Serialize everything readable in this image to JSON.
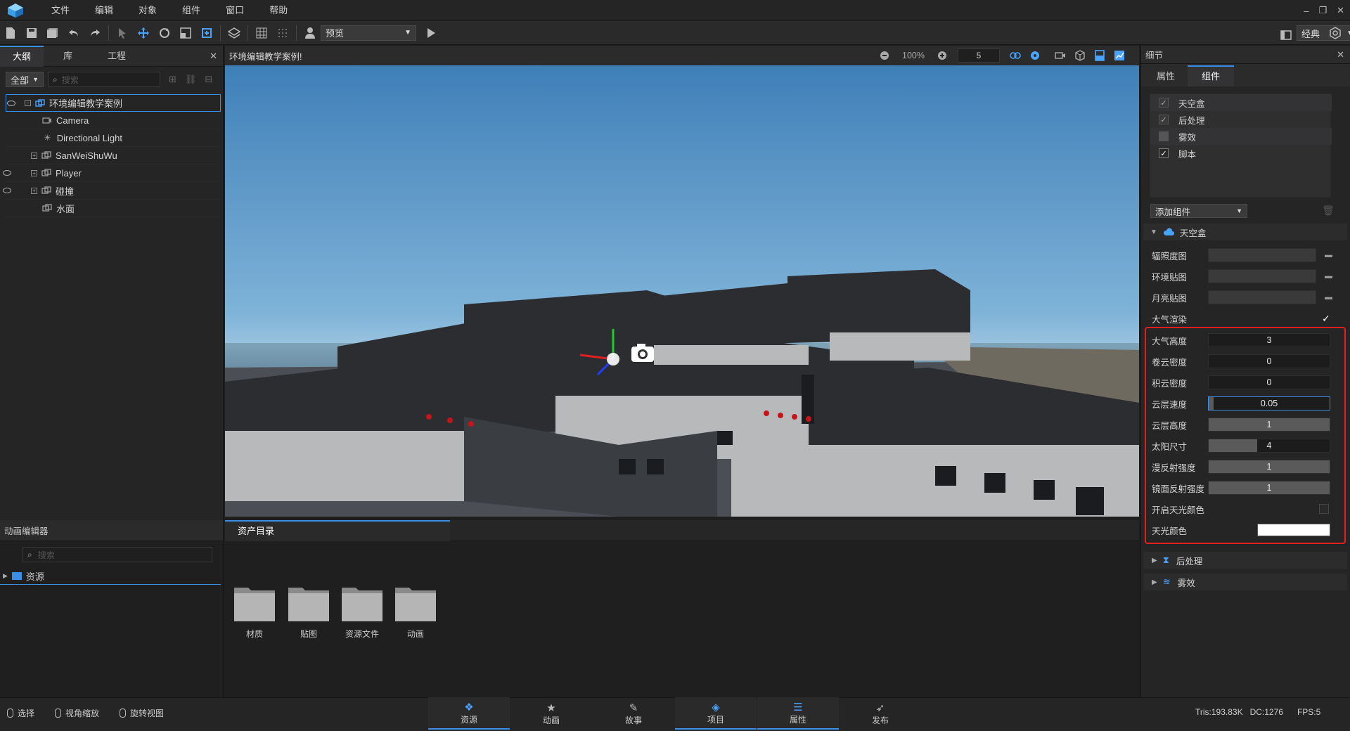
{
  "menu": {
    "items": [
      "文件",
      "编辑",
      "对象",
      "组件",
      "窗口",
      "帮助"
    ]
  },
  "window_controls": {
    "minimize": "–",
    "restore": "❐",
    "close": "✕"
  },
  "toolbar": {
    "preview_select": "预览",
    "layout_select": "经典"
  },
  "outline": {
    "tabs": [
      "大纲",
      "库",
      "工程"
    ],
    "filter": "全部",
    "search_placeholder": "搜索",
    "tree": [
      {
        "label": "环境编辑教学案例"
      },
      {
        "label": "Camera"
      },
      {
        "label": "Directional Light"
      },
      {
        "label": "SanWeiShuWu"
      },
      {
        "label": "Player"
      },
      {
        "label": "碰撞"
      },
      {
        "label": "水面"
      }
    ]
  },
  "viewport": {
    "title": "环境编辑教学案例!",
    "zoom": "100%",
    "speed": "5"
  },
  "details": {
    "title": "细节",
    "tabs": [
      "属性",
      "组件"
    ],
    "components": [
      {
        "label": "天空盒",
        "checked": true
      },
      {
        "label": "后处理",
        "checked": true
      },
      {
        "label": "雾效",
        "checked": false
      },
      {
        "label": "脚本",
        "checked": true
      }
    ],
    "add_component": "添加组件",
    "skybox_section": "天空盒",
    "skybox_props": [
      {
        "label": "辐照度图"
      },
      {
        "label": "环境贴图"
      },
      {
        "label": "月亮贴图"
      },
      {
        "label": "大气渲染"
      }
    ],
    "atmosphere": [
      {
        "label": "大气高度",
        "value": "3"
      },
      {
        "label": "卷云密度",
        "value": "0"
      },
      {
        "label": "积云密度",
        "value": "0"
      },
      {
        "label": "云层速度",
        "value": "0.05"
      },
      {
        "label": "云层高度",
        "value": "1",
        "fill": 1
      },
      {
        "label": "太阳尺寸",
        "value": "4",
        "fill": 0.4
      },
      {
        "label": "漫反射强度",
        "value": "1",
        "fill": 1
      },
      {
        "label": "镜面反射强度",
        "value": "1",
        "fill": 1
      },
      {
        "label": "开启天光颜色"
      },
      {
        "label": "天光颜色",
        "color": "#ffffff"
      }
    ],
    "collapsed_sections": [
      "后处理",
      "雾效"
    ]
  },
  "anim_editor": {
    "title": "动画编辑器",
    "search_placeholder": "搜索",
    "root": "资源"
  },
  "assets": {
    "tab": "资产目录",
    "folders": [
      "材质",
      "贴图",
      "资源文件",
      "动画"
    ]
  },
  "statusbar": {
    "modes": [
      "选择",
      "视角缩放",
      "旋转视图"
    ],
    "tabs": [
      "资源",
      "动画",
      "故事",
      "项目",
      "属性",
      "发布"
    ],
    "stats": {
      "tris": "Tris:193.83K",
      "dc": "DC:1276",
      "fps": "FPS:5"
    }
  },
  "colors": {
    "accent": "#3a8ee6",
    "highlight_border": "#e02020"
  }
}
